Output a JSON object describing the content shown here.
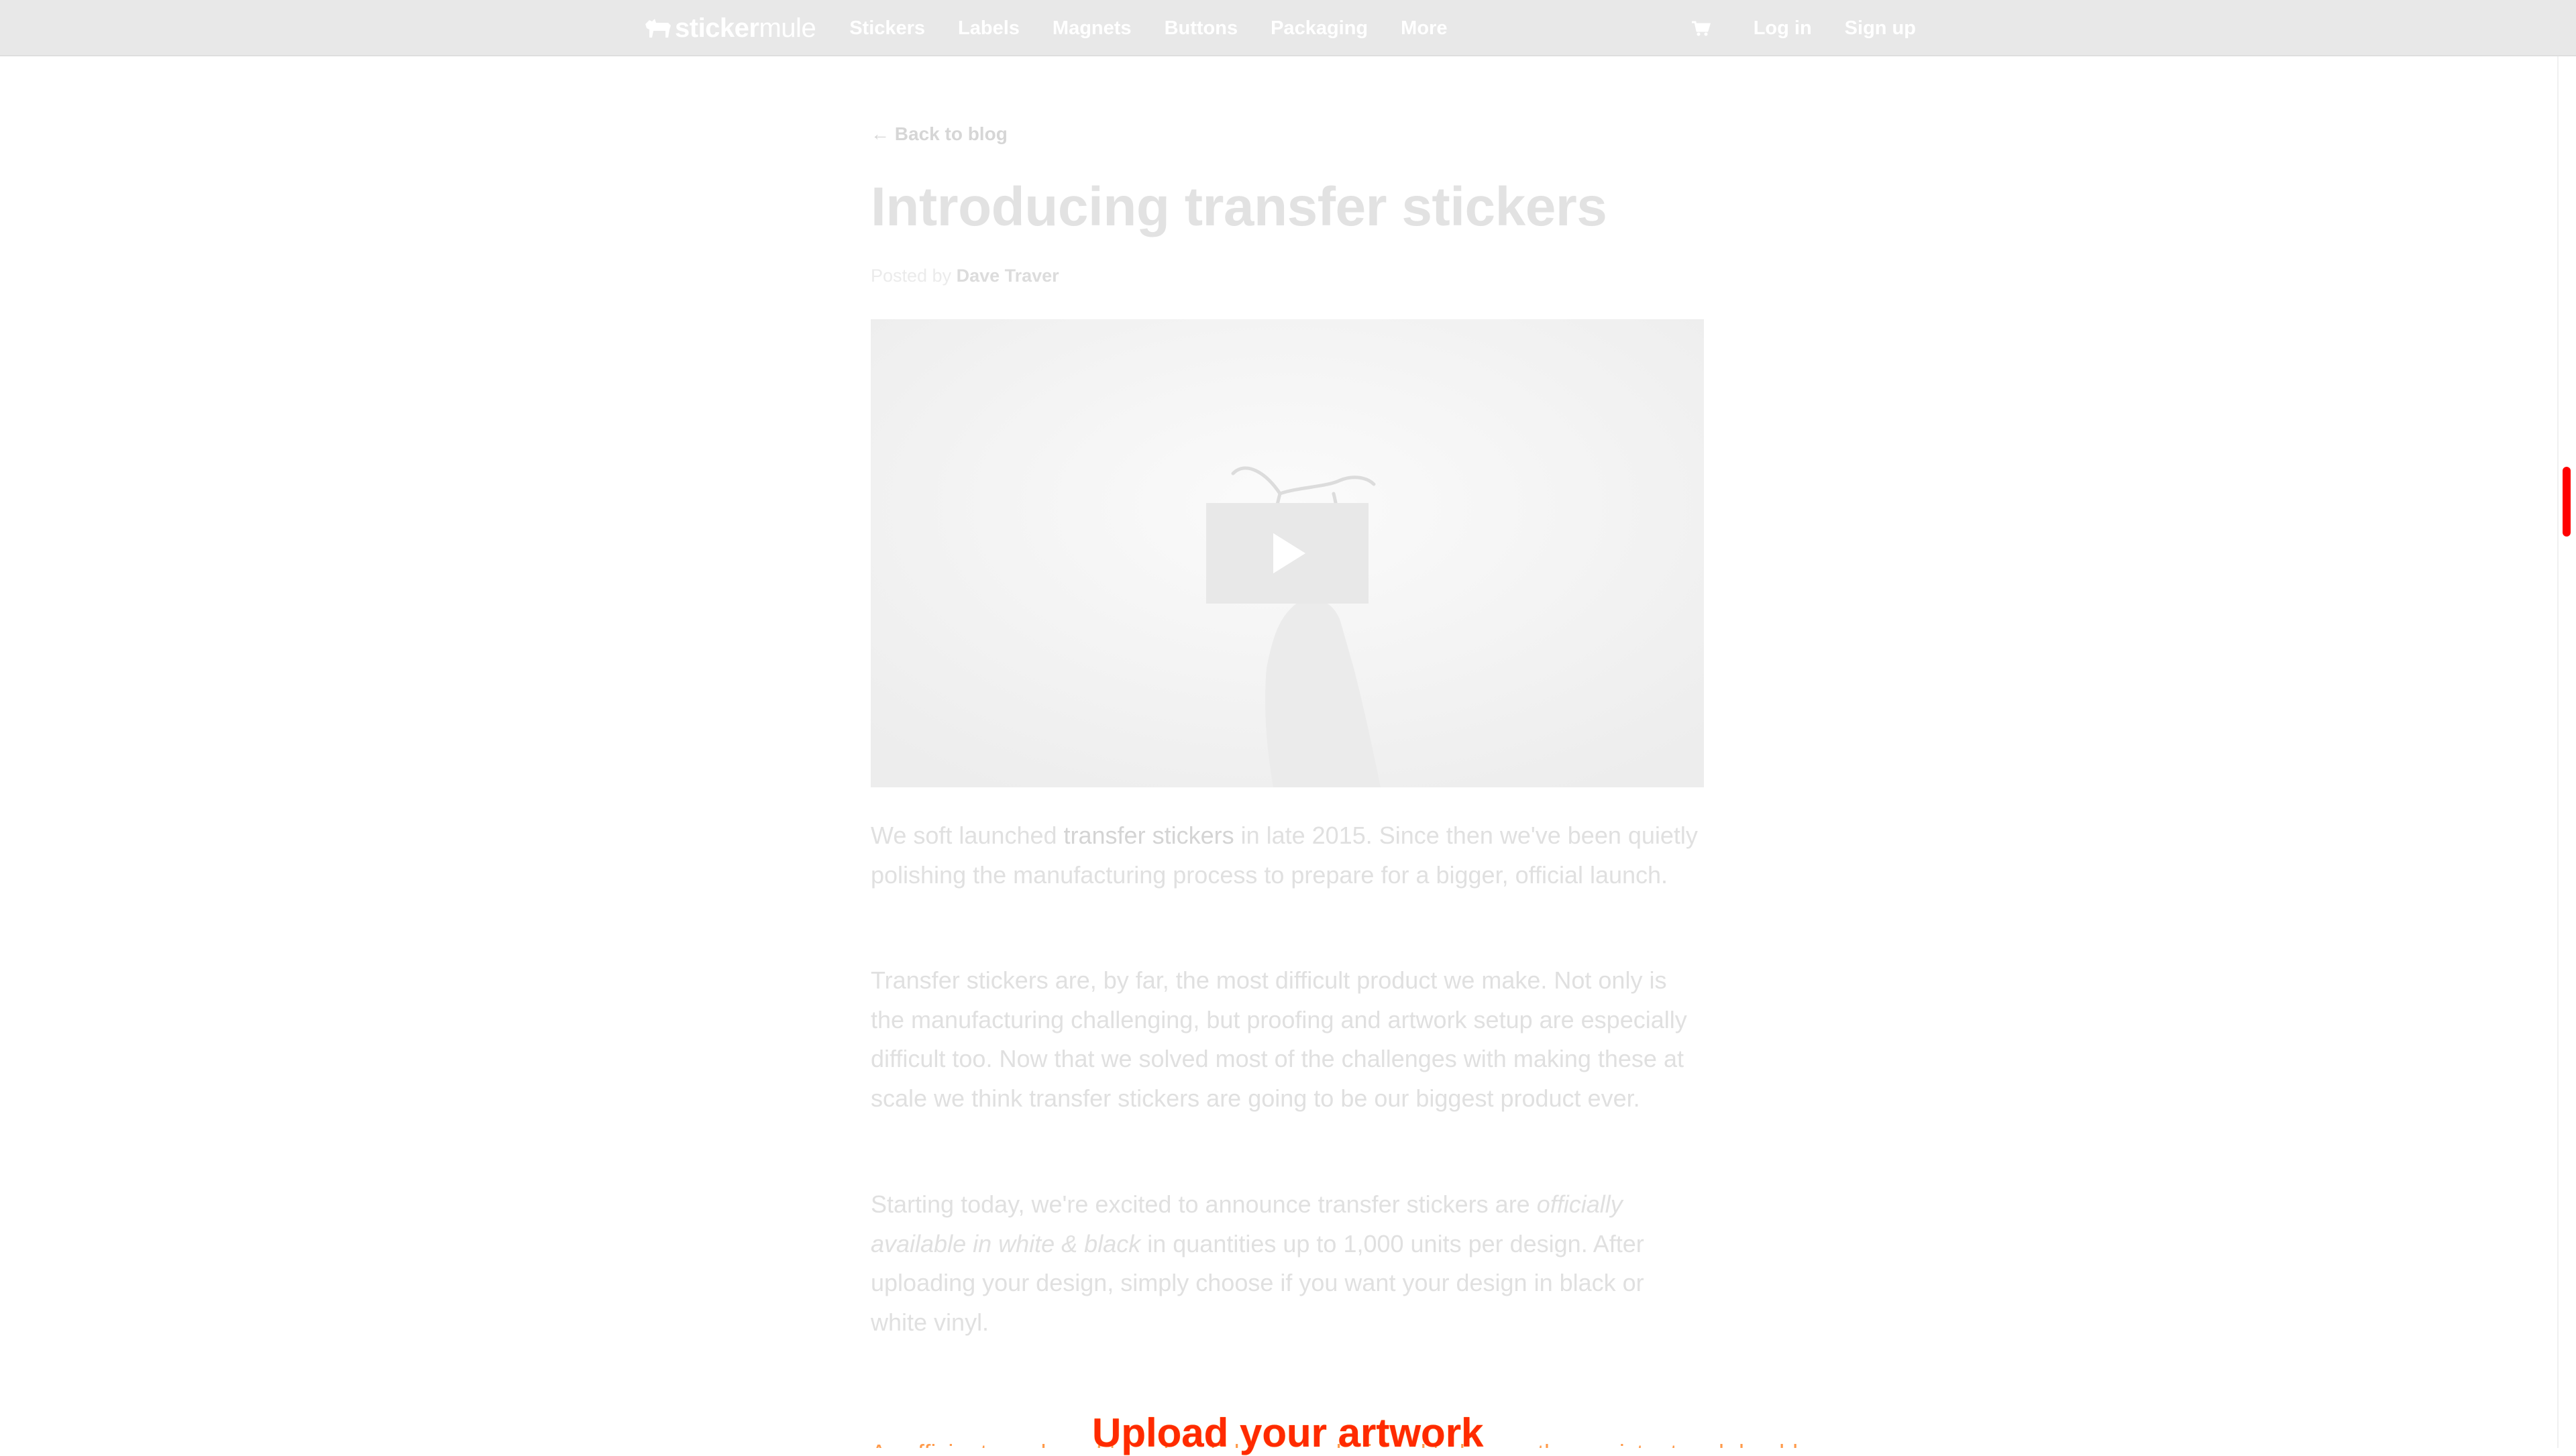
{
  "brand": {
    "logo_part1": "sticker",
    "logo_part2": "mule",
    "logo_icon": "mule-icon",
    "accent": "#ff0000"
  },
  "nav": {
    "items": [
      {
        "label": "Stickers"
      },
      {
        "label": "Labels"
      },
      {
        "label": "Magnets"
      },
      {
        "label": "Buttons"
      },
      {
        "label": "Packaging"
      },
      {
        "label": "More"
      }
    ],
    "cart_icon": "cart-icon",
    "login": "Log in",
    "signup": "Sign up"
  },
  "article": {
    "back_link": "← Back to blog",
    "title": "Introducing transfer stickers",
    "byline_prefix": "Posted by ",
    "author": "Dave Traver",
    "video": {
      "play_icon": "play-icon"
    },
    "p1": {
      "before": "We soft launched ",
      "link": "transfer stickers",
      "after": " in late 2015. Since then we've been quietly polishing the manufacturing process to prepare for a bigger, official launch."
    },
    "p2": "Transfer stickers are, by far, the most difficult product we make. Not only is the manufacturing challenging, but proofing and artwork setup are especially difficult too. Now that we solved most of the challenges with making these at scale we think transfer stickers are going to be our biggest product ever.",
    "p3": {
      "before": "Starting today, we're excited to announce transfer stickers are ",
      "emphasis": "officially available in white & black",
      "after": " in quantities up to 1,000 units per design. After uploading your design, simply choose if you want your design in black or white vinyl."
    },
    "upload_label": "Upload your artwork",
    "cut_line": "A sufficient number of transfer stickers are designed to be weather resistant and durable"
  }
}
